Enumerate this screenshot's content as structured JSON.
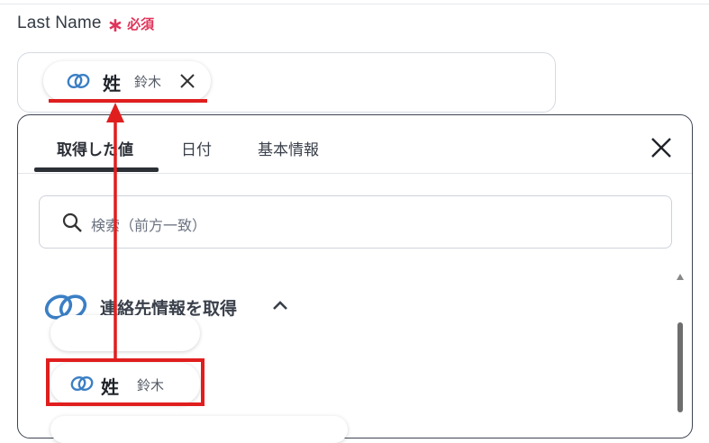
{
  "field": {
    "label": "Last Name",
    "required_mark": "∗",
    "required_text": "必須"
  },
  "selected_value": {
    "key": "姓",
    "value": "鈴木"
  },
  "panel": {
    "tabs": [
      {
        "label": "取得した値",
        "active": true
      },
      {
        "label": "日付",
        "active": false
      },
      {
        "label": "基本情報",
        "active": false
      }
    ],
    "search": {
      "placeholder": "検索（前方一致）"
    },
    "group": {
      "title": "連絡先情報を取得"
    },
    "items": [
      {
        "key": "姓",
        "value": "鈴木",
        "highlighted": true
      }
    ]
  },
  "colors": {
    "accent_red": "#e01e1e",
    "required_red": "#e0345a",
    "link_icon_blue": "#3b7fc4"
  },
  "icons": [
    "link-icon",
    "close-icon",
    "search-icon",
    "chevron-up-icon"
  ]
}
